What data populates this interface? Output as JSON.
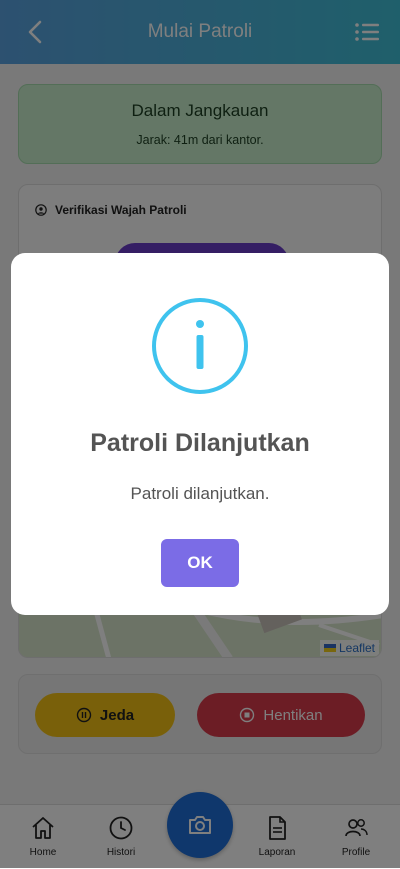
{
  "header": {
    "title": "Mulai Patroli"
  },
  "status": {
    "title": "Dalam Jangkauan",
    "subtitle": "Jarak: 41m dari kantor."
  },
  "verification": {
    "title": "Verifikasi Wajah Patroli"
  },
  "map": {
    "attribution": "Leaflet"
  },
  "actions": {
    "pause_label": "Jeda",
    "stop_label": "Hentikan"
  },
  "bottom_nav": {
    "items": [
      {
        "label": "Home",
        "icon": "home-icon"
      },
      {
        "label": "Histori",
        "icon": "clock-icon"
      },
      {
        "label": "Laporan",
        "icon": "document-icon"
      },
      {
        "label": "Profile",
        "icon": "users-icon"
      }
    ],
    "fab_icon": "camera-icon"
  },
  "modal": {
    "title": "Patroli Dilanjutkan",
    "message": "Patroli dilanjutkan.",
    "ok_label": "OK",
    "icon": "info-icon",
    "accent": "#3fc3ee",
    "button_color": "#7b6ce6"
  },
  "colors": {
    "header_start": "#5aa2e0",
    "header_end": "#3fbfd6",
    "status_bg": "#c9eecd",
    "pause": "#f3c114",
    "stop": "#d83a4b",
    "fab": "#1e6fd8"
  }
}
